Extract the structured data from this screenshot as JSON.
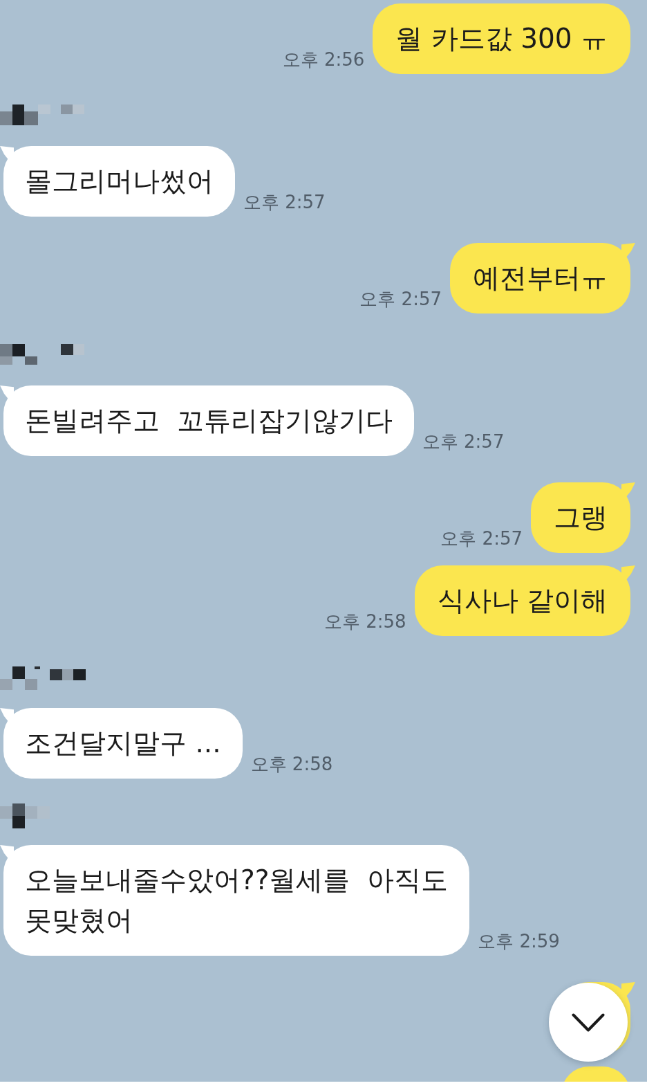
{
  "messages": [
    {
      "kind": "sent",
      "tail": false,
      "text": "월 카드값 300 ㅠ",
      "time": "오후 2:56"
    },
    {
      "kind": "received",
      "tail": true,
      "text": "몰그리머나썼어",
      "time": "오후 2:57"
    },
    {
      "kind": "sent",
      "tail": true,
      "text": "예전부터ㅠ",
      "time": "오후 2:57"
    },
    {
      "kind": "received",
      "tail": true,
      "text": "돈빌려주고  꼬튜리잡기않기다",
      "time": "오후 2:57"
    },
    {
      "kind": "sent",
      "tail": true,
      "text": "그랭",
      "time": "오후 2:57"
    },
    {
      "kind": "sent",
      "tail": true,
      "text": "식사나 같이해",
      "time": "오후 2:58"
    },
    {
      "kind": "received",
      "tail": true,
      "text": "조건달지말구 ...",
      "time": "오후 2:58"
    },
    {
      "kind": "received",
      "tail": true,
      "text": "오늘보내줄수았어??월세를  아직도\n못맞혔어",
      "time": "오후 2:59"
    },
    {
      "kind": "sent",
      "tail": true
    },
    {
      "kind": "sent",
      "tail": false
    }
  ],
  "scroll_down_button": true
}
